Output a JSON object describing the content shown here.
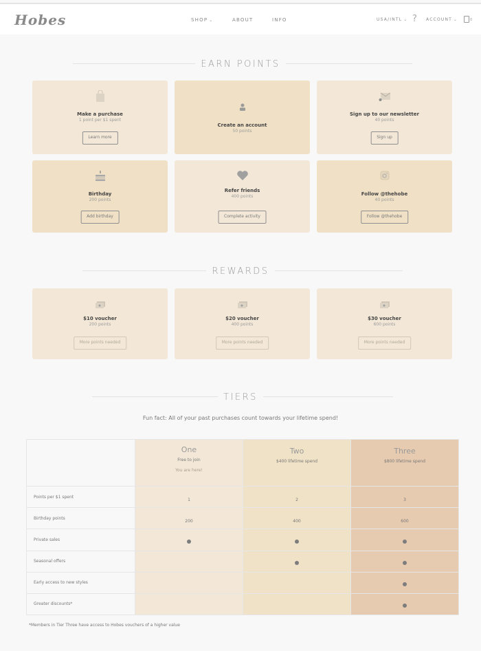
{
  "header": {
    "logo": "Hobes",
    "nav": [
      {
        "label": "SHOP",
        "has_dropdown": true
      },
      {
        "label": "ABOUT",
        "has_dropdown": false
      },
      {
        "label": "INFO",
        "has_dropdown": false
      }
    ],
    "region": "USA/INTL",
    "help": "?",
    "account": "ACCOUNT",
    "cart_count": "0"
  },
  "earn": {
    "title": "EARN POINTS",
    "cards": [
      {
        "icon": "shopping-bag-icon",
        "title": "Make a purchase",
        "sub": "1 point per $1 spent",
        "button": "Learn more"
      },
      {
        "icon": "user-icon",
        "title": "Create an account",
        "sub": "50 points",
        "button": null
      },
      {
        "icon": "newsletter-envelope-icon",
        "title": "Sign up to our newsletter",
        "sub": "40 points",
        "button": "Sign up"
      },
      {
        "icon": "birthday-cake-icon",
        "title": "Birthday",
        "sub": "200 points",
        "button": "Add birthday"
      },
      {
        "icon": "heart-icon",
        "title": "Refer friends",
        "sub": "400 points",
        "button": "Complete activity"
      },
      {
        "icon": "instagram-icon",
        "title": "Follow @thehobe",
        "sub": "40 points",
        "button": "Follow @thehobe"
      }
    ]
  },
  "rewards": {
    "title": "REWARDS",
    "cards": [
      {
        "icon": "voucher-icon",
        "title": "$10 voucher",
        "sub": "200 points",
        "button": "More points needed"
      },
      {
        "icon": "voucher-icon",
        "title": "$20 voucher",
        "sub": "400 points",
        "button": "More points needed"
      },
      {
        "icon": "voucher-icon",
        "title": "$30 voucher",
        "sub": "600 points",
        "button": "More points needed"
      }
    ]
  },
  "tiers": {
    "title": "TIERS",
    "fun_fact": "Fun fact: All of your past purchases count towards your lifetime spend!",
    "columns": [
      {
        "name": "One",
        "requirement": "Free to join",
        "status": "You are here!"
      },
      {
        "name": "Two",
        "requirement": "$400 lifetime spend",
        "status": ""
      },
      {
        "name": "Three",
        "requirement": "$800 lifetime spend",
        "status": ""
      }
    ],
    "rows": [
      {
        "label": "Points per $1 spent",
        "values": [
          "1",
          "2",
          "3"
        ]
      },
      {
        "label": "Birthday points",
        "values": [
          "200",
          "400",
          "600"
        ]
      },
      {
        "label": "Private sales",
        "values": [
          true,
          true,
          true
        ]
      },
      {
        "label": "Seasonal offers",
        "values": [
          false,
          true,
          true
        ]
      },
      {
        "label": "Early access to new styles",
        "values": [
          false,
          false,
          true
        ]
      },
      {
        "label": "Greater discounts*",
        "values": [
          false,
          false,
          true
        ]
      }
    ],
    "footnote": "*Members in Tier Three have access to Hobes vouchers of a higher value"
  },
  "colors": {
    "card_light": "#f3e8d7",
    "card_dark": "#f0e1c6",
    "tier_one": "#f3e8d7",
    "tier_two": "#f0e2c6",
    "tier_three": "#e7cbb0",
    "page_bg": "#f8f8f8"
  }
}
